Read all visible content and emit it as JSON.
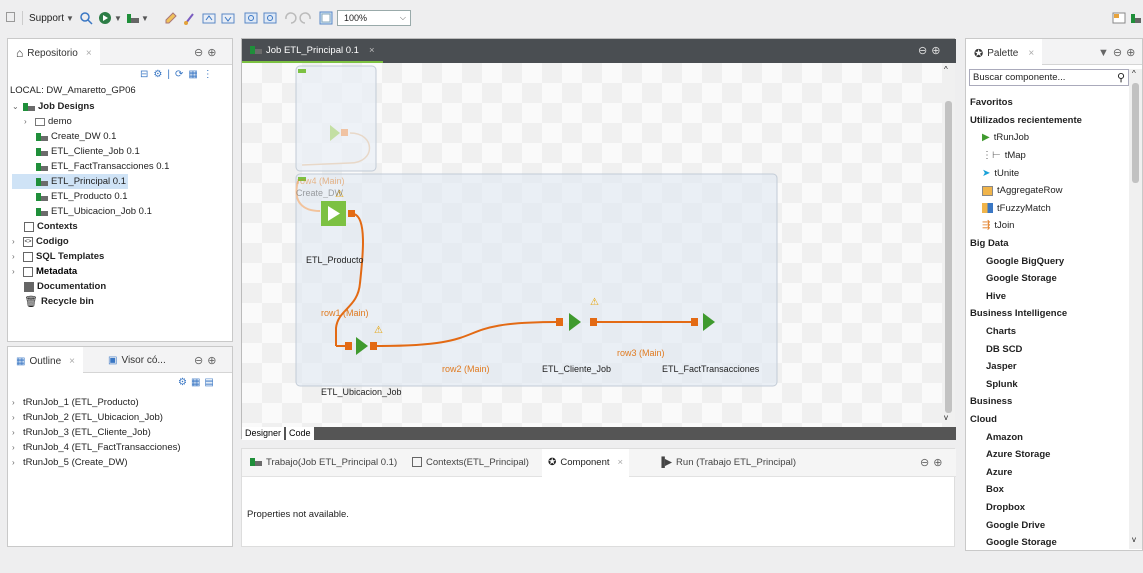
{
  "toolbar": {
    "run_label": "Support",
    "zoom": "100%"
  },
  "repository": {
    "tab_label": "Repositorio",
    "local_label": "LOCAL: DW_Amaretto_GP06",
    "tree": {
      "job_designs": "Job Designs",
      "demo": "demo",
      "jobs": [
        "Create_DW 0.1",
        "ETL_Cliente_Job 0.1",
        "ETL_FactTransacciones 0.1",
        "ETL_Principal 0.1",
        "ETL_Producto 0.1",
        "ETL_Ubicacion_Job 0.1"
      ],
      "contexts": "Contexts",
      "codigo": "Codigo",
      "sql": "SQL Templates",
      "metadata": "Metadata",
      "documentation": "Documentation",
      "recycle": "Recycle bin"
    }
  },
  "outline": {
    "tab_outline": "Outline",
    "tab_visor": "Visor có...",
    "items": [
      "tRunJob_1 (ETL_Producto)",
      "tRunJob_2 (ETL_Ubicacion_Job)",
      "tRunJob_3 (ETL_Cliente_Job)",
      "tRunJob_4 (ETL_FactTransacciones)",
      "tRunJob_5 (Create_DW)"
    ]
  },
  "editor": {
    "tab_label": "Job ETL_Principal 0.1",
    "designer": "Designer",
    "code": "Code",
    "nodes": {
      "create_dw": "Create_DW",
      "producto": "ETL_Producto",
      "ubicacion": "ETL_Ubicacion_Job",
      "cliente": "ETL_Cliente_Job",
      "fact": "ETL_FactTransacciones"
    },
    "links": {
      "row4": "row4 (Main)",
      "row1": "row1 (Main)",
      "row2": "row2 (Main)",
      "row3": "row3 (Main)"
    }
  },
  "bottom": {
    "tabs": [
      "Trabajo(Job ETL_Principal 0.1)",
      "Contexts(ETL_Principal)",
      "Component",
      "Run (Trabajo ETL_Principal)"
    ],
    "message": "Properties not available."
  },
  "palette": {
    "tab_label": "Palette",
    "search_placeholder": "Buscar componente...",
    "rows": [
      {
        "t": "Favoritos",
        "k": "cat"
      },
      {
        "t": "Utilizados recientemente",
        "k": "cat"
      },
      {
        "t": "tRunJob",
        "k": "item",
        "ic": "run"
      },
      {
        "t": "tMap",
        "k": "item",
        "ic": "map"
      },
      {
        "t": "tUnite",
        "k": "item",
        "ic": "unite"
      },
      {
        "t": "tAggregateRow",
        "k": "item",
        "ic": "agg"
      },
      {
        "t": "tFuzzyMatch",
        "k": "item",
        "ic": "fuzzy"
      },
      {
        "t": "tJoin",
        "k": "item",
        "ic": "join"
      },
      {
        "t": "Big Data",
        "k": "cat"
      },
      {
        "t": "Google BigQuery",
        "k": "sub"
      },
      {
        "t": "Google Storage",
        "k": "sub"
      },
      {
        "t": "Hive",
        "k": "sub"
      },
      {
        "t": "Business Intelligence",
        "k": "cat"
      },
      {
        "t": "Charts",
        "k": "sub"
      },
      {
        "t": "DB SCD",
        "k": "sub"
      },
      {
        "t": "Jasper",
        "k": "sub"
      },
      {
        "t": "Splunk",
        "k": "sub"
      },
      {
        "t": "Business",
        "k": "cat"
      },
      {
        "t": "Cloud",
        "k": "cat"
      },
      {
        "t": "Amazon",
        "k": "sub"
      },
      {
        "t": "Azure Storage",
        "k": "sub"
      },
      {
        "t": "Azure",
        "k": "sub"
      },
      {
        "t": "Box",
        "k": "sub"
      },
      {
        "t": "Dropbox",
        "k": "sub"
      },
      {
        "t": "Google Drive",
        "k": "sub"
      },
      {
        "t": "Google Storage",
        "k": "sub"
      }
    ]
  }
}
